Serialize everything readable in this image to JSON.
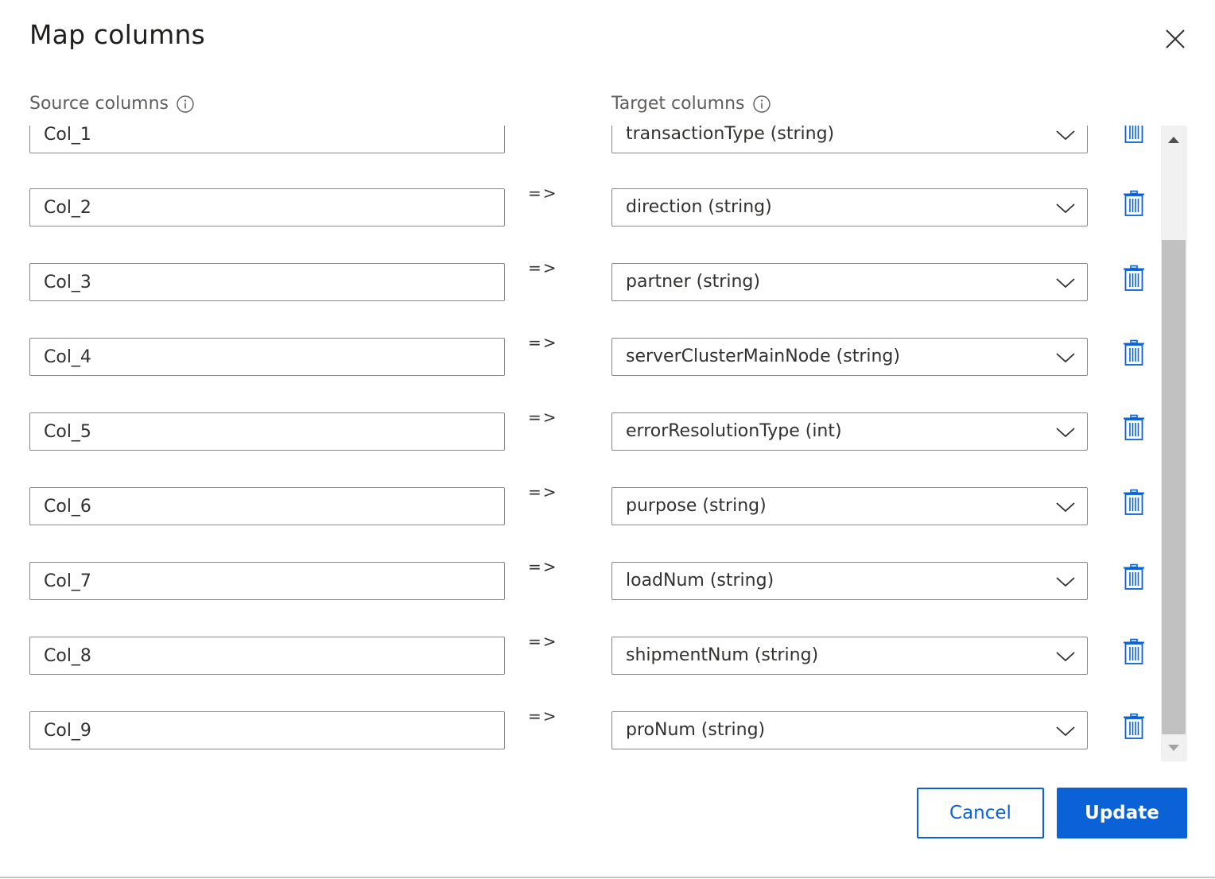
{
  "dialog": {
    "title": "Map columns",
    "close_icon": "close-icon"
  },
  "headers": {
    "source": "Source columns",
    "target": "Target columns",
    "info_icon": "info-icon"
  },
  "mappings": [
    {
      "source": "Col_1",
      "arrow": "=>",
      "target": "transactionType (string)"
    },
    {
      "source": "Col_2",
      "arrow": "=>",
      "target": "direction (string)"
    },
    {
      "source": "Col_3",
      "arrow": "=>",
      "target": "partner (string)"
    },
    {
      "source": "Col_4",
      "arrow": "=>",
      "target": "serverClusterMainNode (string)"
    },
    {
      "source": "Col_5",
      "arrow": "=>",
      "target": "errorResolutionType (int)"
    },
    {
      "source": "Col_6",
      "arrow": "=>",
      "target": "purpose (string)"
    },
    {
      "source": "Col_7",
      "arrow": "=>",
      "target": "loadNum (string)"
    },
    {
      "source": "Col_8",
      "arrow": "=>",
      "target": "shipmentNum (string)"
    },
    {
      "source": "Col_9",
      "arrow": "=>",
      "target": "proNum (string)"
    }
  ],
  "actions": {
    "cancel_label": "Cancel",
    "update_label": "Update"
  },
  "colors": {
    "accent": "#0b62d6",
    "border": "#8a8886",
    "muted_text": "#605e5c"
  }
}
